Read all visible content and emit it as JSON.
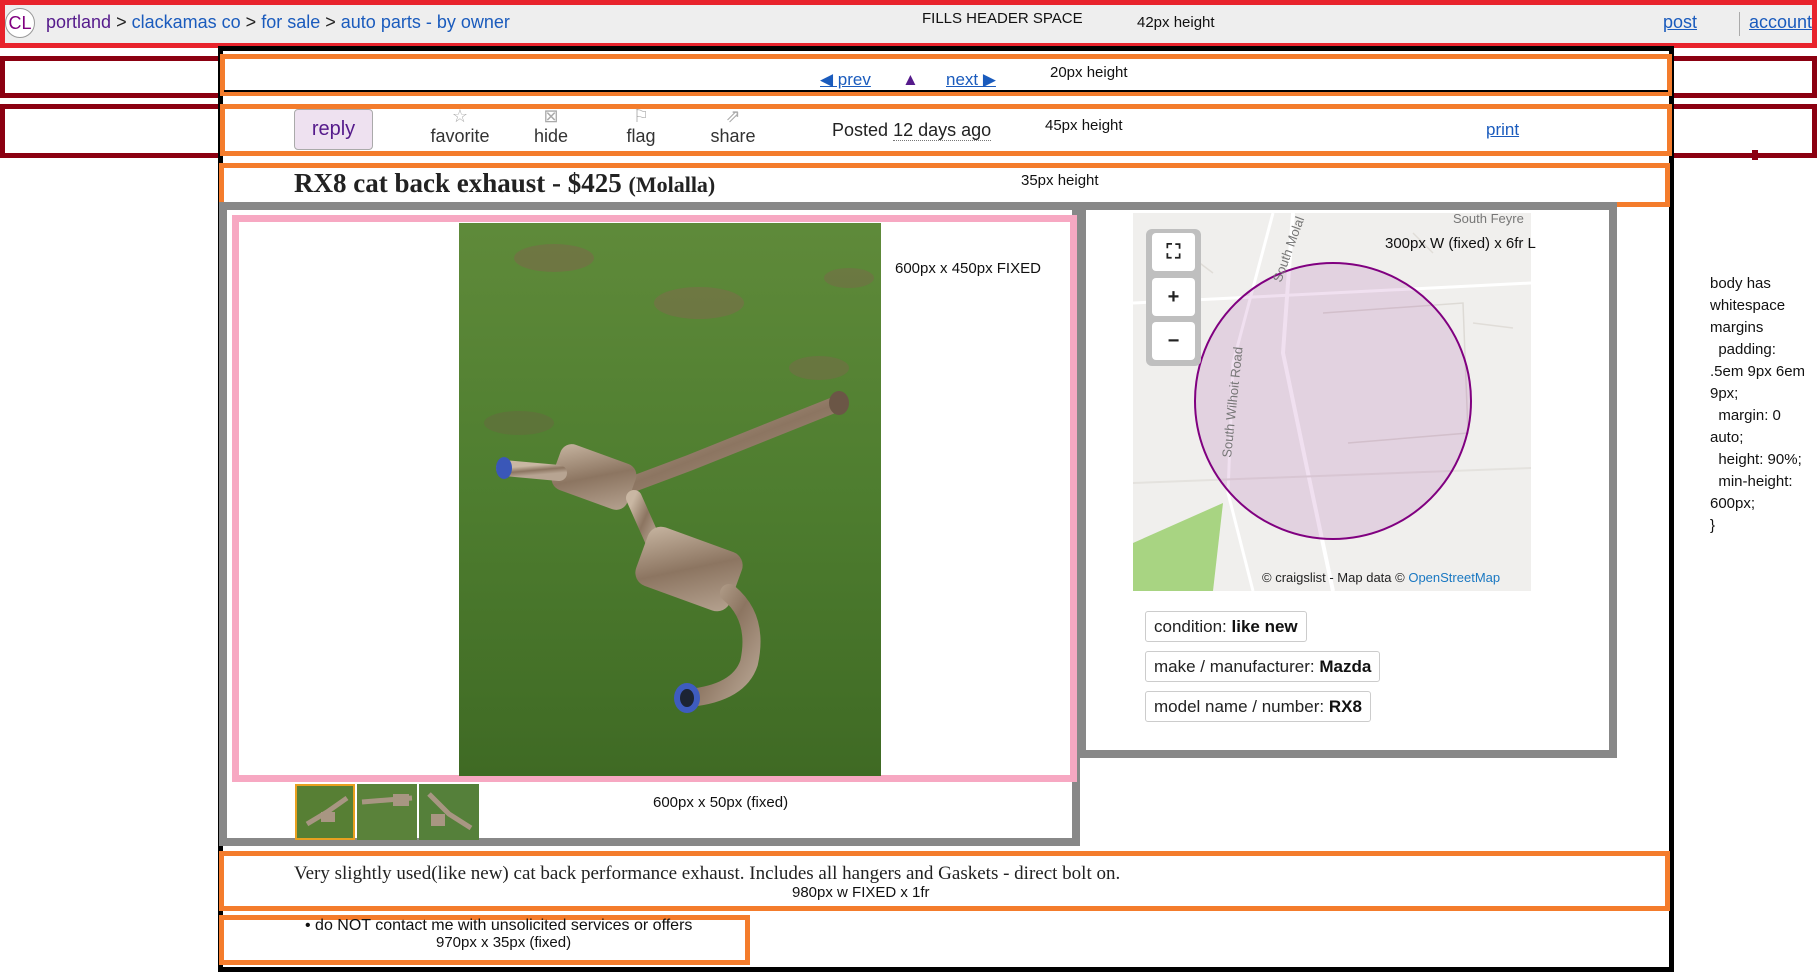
{
  "header": {
    "logo": "CL",
    "breadcrumb": [
      "portland",
      "clackamas co",
      "for sale",
      "auto parts - by owner"
    ],
    "separator": ">",
    "fills_note": "FILLS HEADER SPACE",
    "height_note": "42px height",
    "post_label": "post",
    "account_label": "account"
  },
  "nav": {
    "prev_label": "◀ prev",
    "up_label": "▲",
    "next_label": "next ▶",
    "height_note": "20px height"
  },
  "actions": {
    "reply_label": "reply",
    "items": [
      {
        "label": "favorite",
        "icon": "☆"
      },
      {
        "label": "hide",
        "icon": "⊠"
      },
      {
        "label": "flag",
        "icon": "⚐"
      },
      {
        "label": "share",
        "icon": "⇗"
      }
    ],
    "posted_prefix": "Posted",
    "posted_when": "12 days ago",
    "height_note": "45px height",
    "print_label": "print"
  },
  "posting": {
    "title": "RX8 cat back exhaust - $425",
    "location": "(Molalla)",
    "height_note": "35px height"
  },
  "gallery": {
    "size_note": "600px x 450px FIXED",
    "thumb_note": "600px x 50px (fixed)"
  },
  "map": {
    "size_note": "300px W (fixed) x 6fr L",
    "roads": [
      "South Feyre",
      "South Molal",
      "South Wilhoit Road"
    ],
    "attribution_prefix": "© craigslist - Map data ©",
    "attribution_link": "OpenStreetMap"
  },
  "attributes": [
    {
      "label": "condition:",
      "value": "like new"
    },
    {
      "label": "make / manufacturer:",
      "value": "Mazda"
    },
    {
      "label": "model name / number:",
      "value": "RX8"
    }
  ],
  "description": {
    "text": "Very slightly used(like new) cat back performance exhaust. Includes all hangers and Gaskets - direct bolt on.",
    "size_note": "980px w FIXED x 1fr"
  },
  "notices": {
    "items": [
      "do NOT contact me with unsolicited services or offers"
    ],
    "size_note": "970px x 35px (fixed)"
  },
  "annotations": {
    "body_note": "body has\nwhitespace\nmargins\n  padding:\n.5em 9px 6em\n9px;\n  margin: 0\nauto;\n  height: 90%;\n  min-height:\n600px;\n}"
  },
  "colors": {
    "header_border": "#e8232c",
    "band_border": "#8b0011",
    "row_border": "#f47c2c",
    "gallery_frame": "#888888",
    "image_frame": "#f7a8c2",
    "map_circle": "#800080",
    "link": "#1a5bbd"
  }
}
